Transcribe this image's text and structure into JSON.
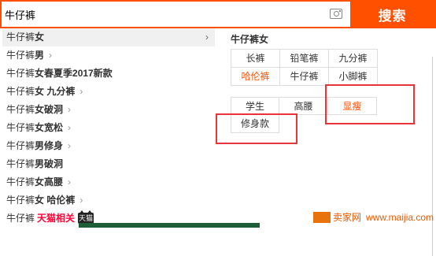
{
  "search": {
    "query": "牛仔裤",
    "button_label": "搜索",
    "camera_icon": "camera-icon"
  },
  "suggestions": [
    {
      "q": "牛仔裤",
      "tail": "女",
      "has_chevron": true,
      "active": true
    },
    {
      "q": "牛仔裤",
      "tail": "男",
      "has_chevron": true
    },
    {
      "q": "牛仔裤",
      "tail": "女春夏季2017新款",
      "has_chevron": false
    },
    {
      "q": "牛仔裤",
      "tail": "女 九分裤",
      "has_chevron": true
    },
    {
      "q": "牛仔裤",
      "tail": "女破洞",
      "has_chevron": true
    },
    {
      "q": "牛仔裤",
      "tail": "女宽松",
      "has_chevron": true
    },
    {
      "q": "牛仔裤",
      "tail": "男修身",
      "has_chevron": true
    },
    {
      "q": "牛仔裤",
      "tail": "男破洞",
      "has_chevron": false
    },
    {
      "q": "牛仔裤",
      "tail": "女高腰",
      "has_chevron": true
    },
    {
      "q": "牛仔裤",
      "tail": "女 哈伦裤",
      "has_chevron": true
    },
    {
      "q": "牛仔裤",
      "tail": "",
      "has_chevron": false
    }
  ],
  "tmall": {
    "label": "天猫相关",
    "icon_text": "天猫"
  },
  "chevron_glyph": "›",
  "panel": {
    "title": "牛仔裤女",
    "group1": [
      "长裤",
      "铅笔裤",
      "九分裤",
      "哈伦裤",
      "牛仔裤",
      "小脚裤"
    ],
    "group2": [
      "学生",
      "高腰",
      "显瘦",
      "修身款"
    ]
  },
  "watermark": {
    "brand": "卖家网",
    "url": "www.maijia.com"
  },
  "colors": {
    "brand_orange": "#ff5000",
    "highlight_red": "#e8343a",
    "tag_hot": "#ff5000",
    "tmall_red": "#ff0036"
  }
}
